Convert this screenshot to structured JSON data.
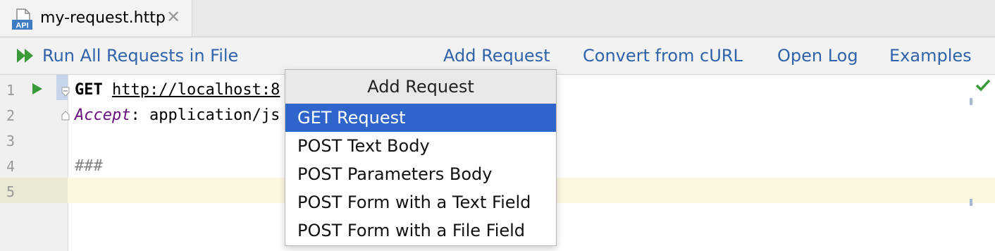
{
  "tab": {
    "icon_label": "API",
    "title": "my-request.http",
    "close_glyph": "✕"
  },
  "toolbar": {
    "run_all_label": "Run All Requests in File",
    "add_request_label": "Add Request",
    "convert_label": "Convert from cURL",
    "open_log_label": "Open Log",
    "examples_label": "Examples"
  },
  "editor": {
    "line_numbers": [
      "1",
      "2",
      "3",
      "4",
      "5"
    ],
    "line1": {
      "method": "GET",
      "url": "http://localhost:8"
    },
    "line2": {
      "header_name": "Accept",
      "header_rest": ": application/js"
    },
    "line4": {
      "separator": "###"
    }
  },
  "popup": {
    "title": "Add Request",
    "items": [
      "GET Request",
      "POST Text Body",
      "POST Parameters Body",
      "POST Form with a Text Field",
      "POST Form with a File Field"
    ],
    "selected_index": 0
  },
  "colors": {
    "link": "#2f63aa",
    "selection": "#2f65ca",
    "run_green": "#3a9a3a",
    "header_purple": "#660e7a"
  },
  "icons": {
    "file_type": "http-file-icon",
    "run_all": "double-play-icon",
    "run_line": "play-icon",
    "status": "checkmark-icon"
  }
}
